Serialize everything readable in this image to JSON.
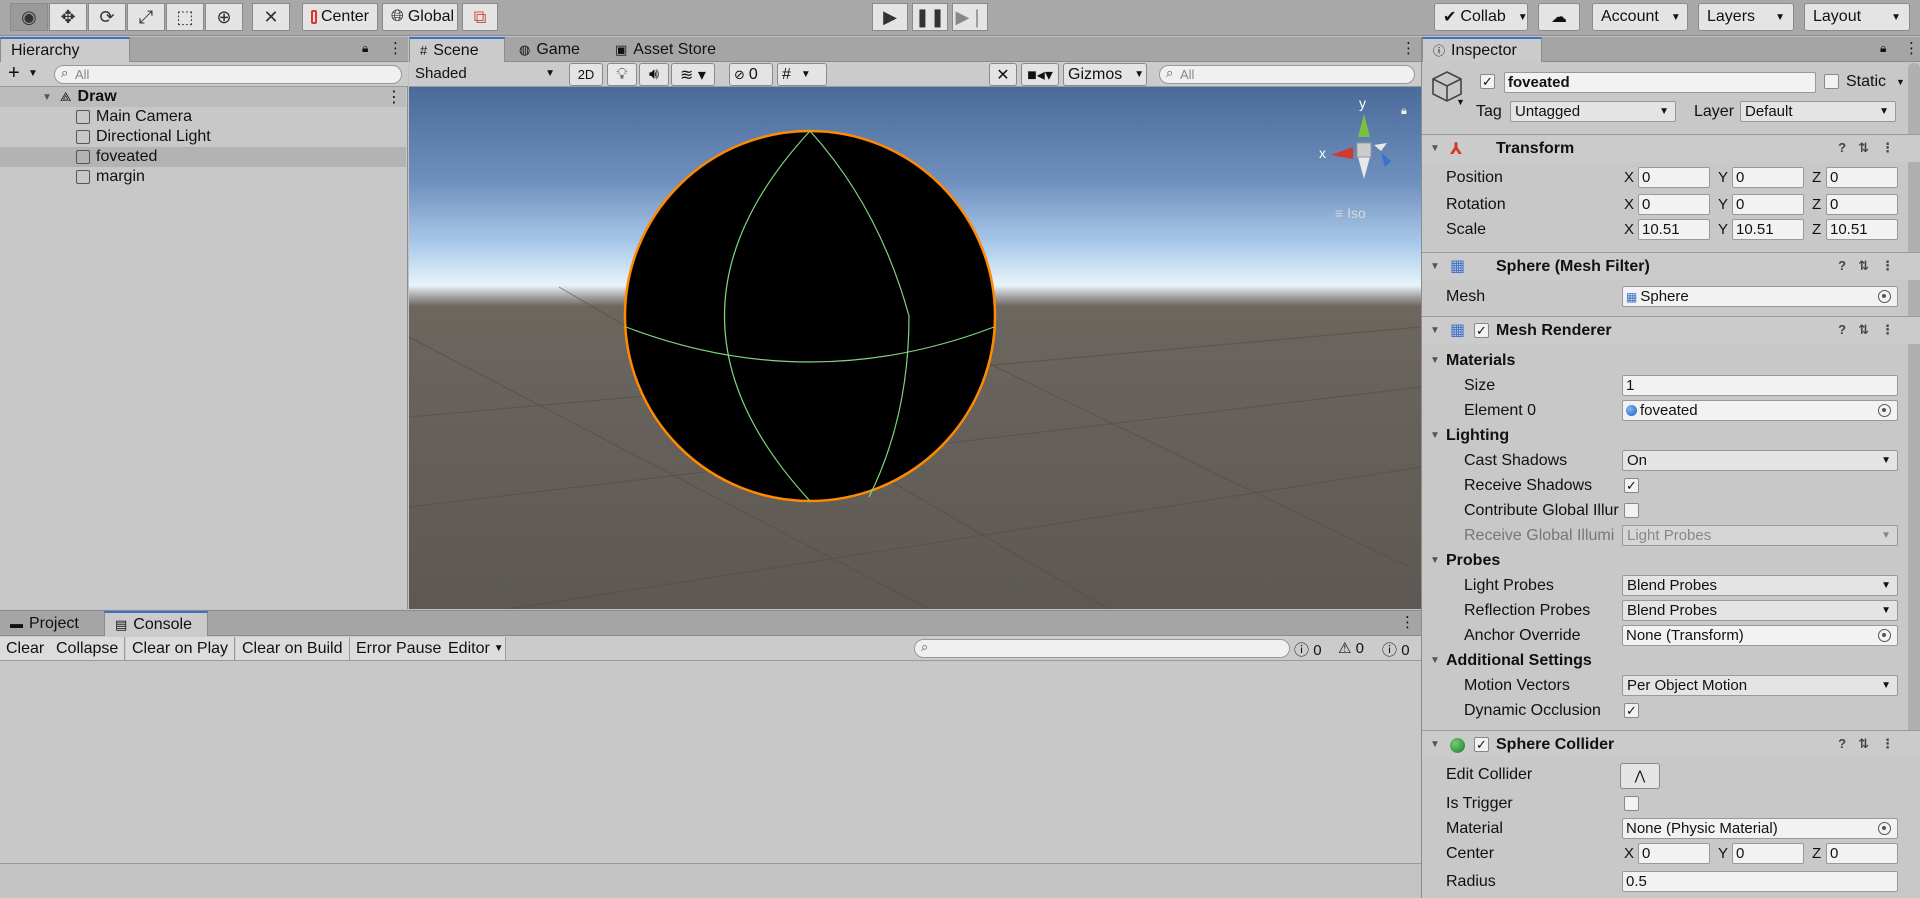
{
  "toolbar": {
    "center_label": "Center",
    "global_label": "Global",
    "collab_label": "Collab",
    "account_label": "Account",
    "layers_label": "Layers",
    "layout_label": "Layout"
  },
  "hierarchy": {
    "tab_label": "Hierarchy",
    "search_placeholder": "All",
    "scene_name": "Draw",
    "items": [
      "Main Camera",
      "Directional Light",
      "foveated",
      "margin"
    ]
  },
  "scene_view": {
    "tabs": [
      "Scene",
      "Game",
      "Asset Store"
    ],
    "shading_mode": "Shaded",
    "mode_2d_label": "2D",
    "hidden_count": "0",
    "gizmos_label": "Gizmos",
    "search_placeholder": "All",
    "gizmo_axis_y": "y",
    "gizmo_axis_x": "x",
    "projection_label": "Iso"
  },
  "console": {
    "tabs": [
      "Project",
      "Console"
    ],
    "buttons": [
      "Clear",
      "Collapse",
      "Clear on Play",
      "Clear on Build",
      "Error Pause",
      "Editor"
    ],
    "counts": [
      "0",
      "0",
      "0"
    ]
  },
  "inspector": {
    "tab_label": "Inspector",
    "object_name": "foveated",
    "static_label": "Static",
    "tag_label": "Tag",
    "tag_value": "Untagged",
    "layer_label": "Layer",
    "layer_value": "Default",
    "transform": {
      "title": "Transform",
      "position_label": "Position",
      "rotation_label": "Rotation",
      "scale_label": "Scale",
      "position": [
        "0",
        "0",
        "0"
      ],
      "rotation": [
        "0",
        "0",
        "0"
      ],
      "scale": [
        "10.51",
        "10.51",
        "10.51"
      ]
    },
    "mesh_filter": {
      "title": "Sphere (Mesh Filter)",
      "mesh_label": "Mesh",
      "mesh_value": "Sphere"
    },
    "mesh_renderer": {
      "title": "Mesh Renderer",
      "materials_label": "Materials",
      "size_label": "Size",
      "size_value": "1",
      "element0_label": "Element 0",
      "element0_value": "foveated",
      "lighting_label": "Lighting",
      "cast_shadows_label": "Cast Shadows",
      "cast_shadows_value": "On",
      "receive_shadows_label": "Receive Shadows",
      "contribute_gi_label": "Contribute Global Illur",
      "receive_gi_label": "Receive Global Illumi",
      "receive_gi_value": "Light Probes",
      "probes_label": "Probes",
      "light_probes_label": "Light Probes",
      "light_probes_value": "Blend Probes",
      "reflection_probes_label": "Reflection Probes",
      "reflection_probes_value": "Blend Probes",
      "anchor_override_label": "Anchor Override",
      "anchor_override_value": "None (Transform)",
      "additional_label": "Additional Settings",
      "motion_vectors_label": "Motion Vectors",
      "motion_vectors_value": "Per Object Motion",
      "dynamic_occlusion_label": "Dynamic Occlusion"
    },
    "sphere_collider": {
      "title": "Sphere Collider",
      "edit_collider_label": "Edit Collider",
      "is_trigger_label": "Is Trigger",
      "material_label": "Material",
      "material_value": "None (Physic Material)",
      "center_label": "Center",
      "center": [
        "0",
        "0",
        "0"
      ],
      "radius_label": "Radius",
      "radius_value": "0.5"
    },
    "axis_labels": [
      "X",
      "Y",
      "Z"
    ]
  },
  "colors": {
    "selection_outline": "#ff8a00",
    "wire": "#7fd37f",
    "accent": "#3a72c9"
  }
}
